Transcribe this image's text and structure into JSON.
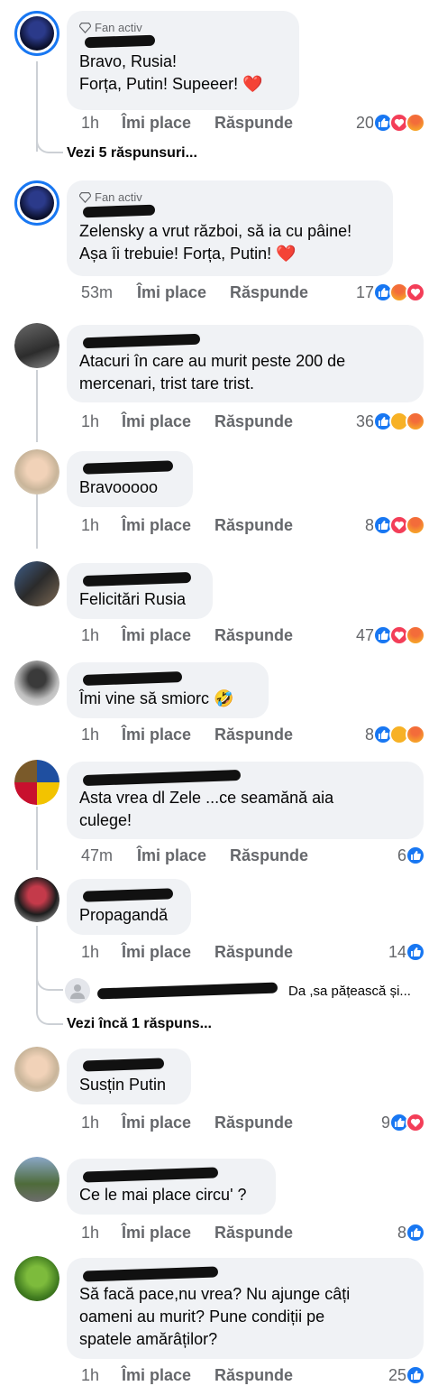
{
  "labels": {
    "like": "Îmi place",
    "reply": "Răspunde",
    "fan_badge": "Fan activ"
  },
  "comments": [
    {
      "text": "Bravo, Rusia!\nForța, Putin!  Supeeer! ❤️",
      "time": "1h",
      "reactions": "20",
      "icons": [
        "like",
        "love",
        "angry"
      ]
    },
    {
      "text": "Zelensky a vrut război, să ia cu pâine!\nAșa îi trebuie! Forța, Putin! ❤️",
      "time": "53m",
      "reactions": "17",
      "icons": [
        "like",
        "angry",
        "love"
      ]
    },
    {
      "text": "Atacuri în care au murit peste 200 de\nmercenari, trist tare trist.",
      "time": "1h",
      "reactions": "36",
      "icons": [
        "like",
        "haha",
        "angry"
      ]
    },
    {
      "text": "Bravooooo",
      "time": "1h",
      "reactions": "8",
      "icons": [
        "like",
        "love",
        "angry"
      ]
    },
    {
      "text": "Felicitări Rusia",
      "time": "1h",
      "reactions": "47",
      "icons": [
        "like",
        "love",
        "angry"
      ]
    },
    {
      "text": "Îmi vine să smiorc 🤣",
      "time": "1h",
      "reactions": "8",
      "icons": [
        "like",
        "haha",
        "angry"
      ]
    },
    {
      "text": "Asta vrea dl Zele ...ce seamănă aia\nculege!",
      "time": "47m",
      "reactions": "6",
      "icons": [
        "like"
      ]
    },
    {
      "text": "Propagandă",
      "time": "1h",
      "reactions": "14",
      "icons": [
        "like"
      ]
    },
    {
      "text": "Susțin Putin",
      "time": "1h",
      "reactions": "9",
      "icons": [
        "like",
        "love"
      ]
    },
    {
      "text": "Ce le mai place circu' ?",
      "time": "1h",
      "reactions": "8",
      "icons": [
        "like"
      ]
    },
    {
      "text": "Să facă pace,nu vrea? Nu ajunge câți\noameni au murit? Pune condiții pe\nspatele amărâților?",
      "time": "1h",
      "reactions": "25",
      "icons": [
        "like"
      ]
    }
  ],
  "more_replies_1": "Vezi 5 răspunsuri...",
  "more_replies_2": "Vezi încă 1 răspuns...",
  "reply_preview_text": "Da ,sa pățească și...",
  "colors": {
    "accent": "#1877f2",
    "bubble": "#f0f2f5",
    "muted": "#65676b"
  }
}
